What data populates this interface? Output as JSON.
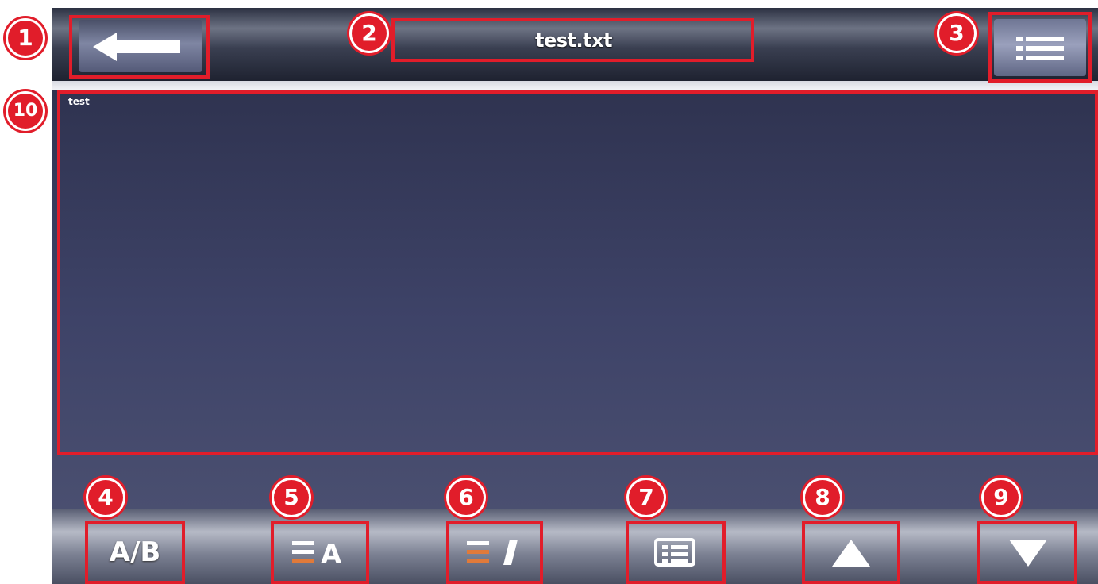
{
  "header": {
    "title": "test.txt",
    "back_icon": "arrow-left-icon",
    "menu_icon": "list-menu-icon"
  },
  "document": {
    "text": "test"
  },
  "toolbar": {
    "ab_label": "A/B",
    "font_size_icon": "text-size-icon",
    "text_color_icon": "text-color-icon",
    "bookmark_list_icon": "bookmark-list-icon",
    "page_up_icon": "triangle-up-icon",
    "page_down_icon": "triangle-down-icon"
  },
  "callouts": [
    "1",
    "2",
    "3",
    "4",
    "5",
    "6",
    "7",
    "8",
    "9",
    "10"
  ],
  "colors": {
    "annotation": "#e11d2a",
    "content_bg": "#3a3f62",
    "accent_bar": "#e07a3a"
  }
}
